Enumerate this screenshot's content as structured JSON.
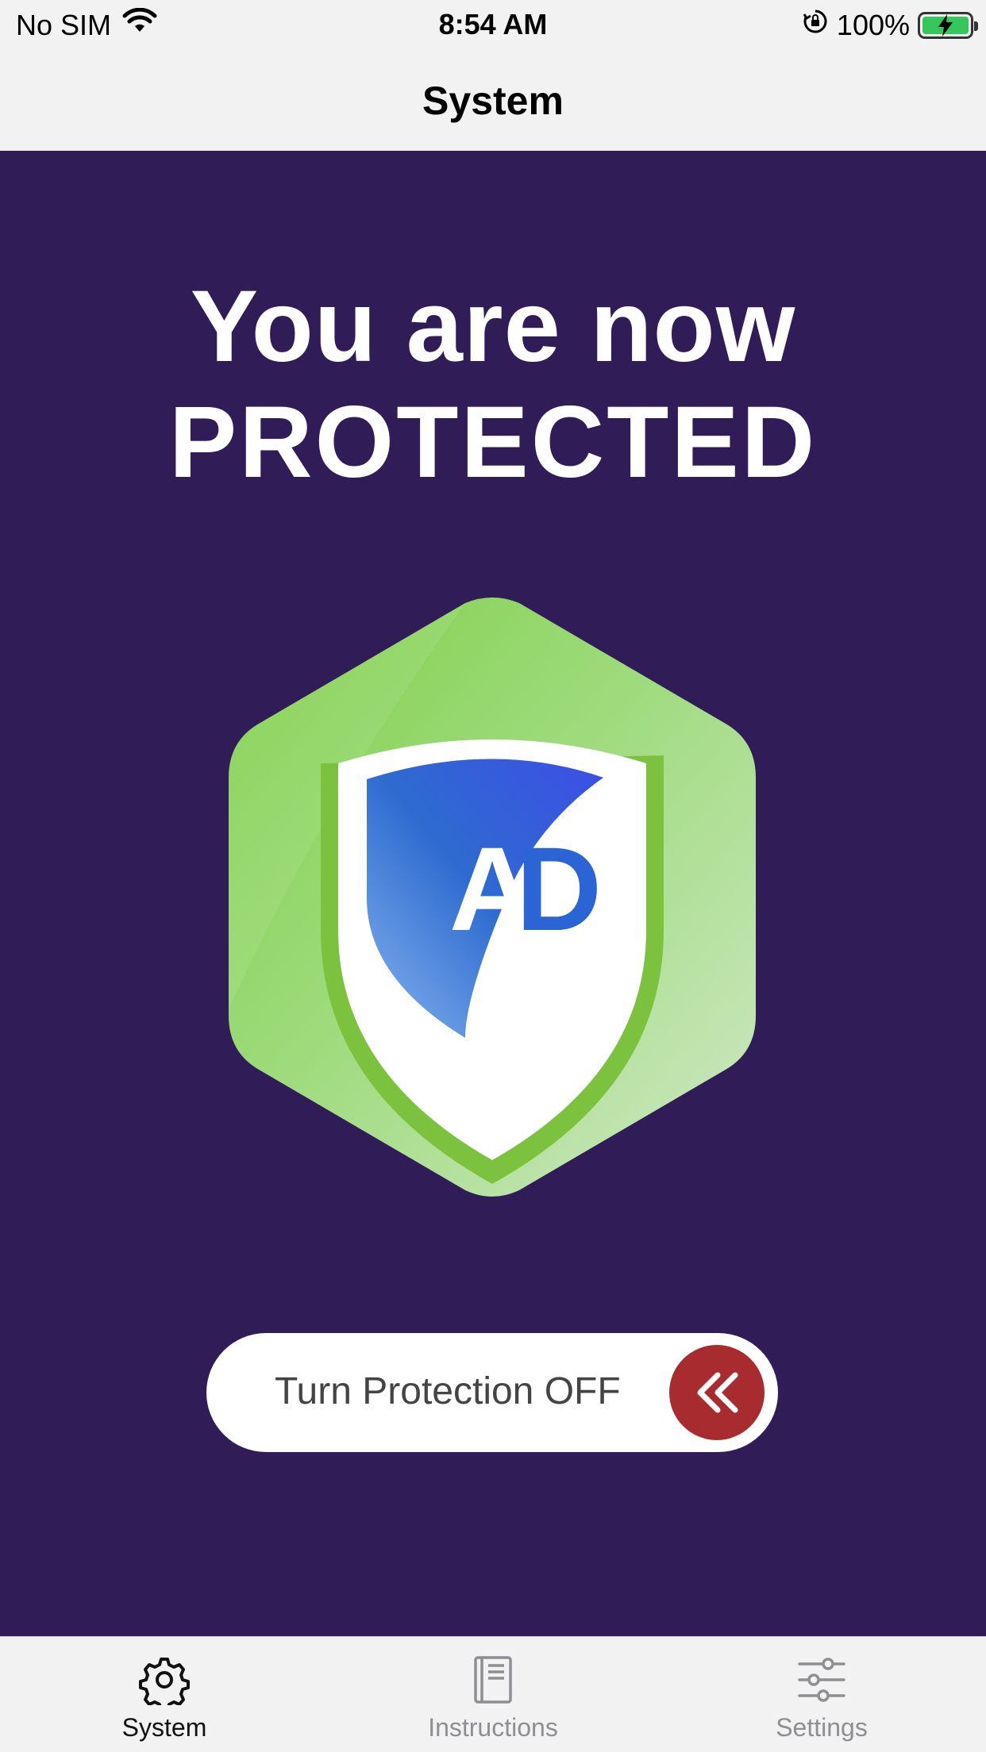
{
  "status_bar": {
    "carrier": "No SIM",
    "time": "8:54 AM",
    "battery_percent": "100%",
    "battery_level": 1.0,
    "icons": [
      "wifi-icon",
      "orientation-lock-icon",
      "battery-charging-icon"
    ]
  },
  "nav": {
    "title": "System"
  },
  "main": {
    "headline_line1": "You are now",
    "headline_line2": "PROTECTED",
    "logo_letters": "AD",
    "toggle": {
      "label": "Turn Protection OFF",
      "knob_icon": "double-chevron-left-icon",
      "state": "on"
    }
  },
  "colors": {
    "background": "#301d58",
    "hexagon_green": "#8fd86a",
    "shield_blue": "#2b64d4",
    "toggle_knob": "#a82b2f"
  },
  "tab_bar": {
    "tabs": [
      {
        "label": "System",
        "icon": "gear-icon",
        "active": true
      },
      {
        "label": "Instructions",
        "icon": "book-icon",
        "active": false
      },
      {
        "label": "Settings",
        "icon": "sliders-icon",
        "active": false
      }
    ]
  }
}
